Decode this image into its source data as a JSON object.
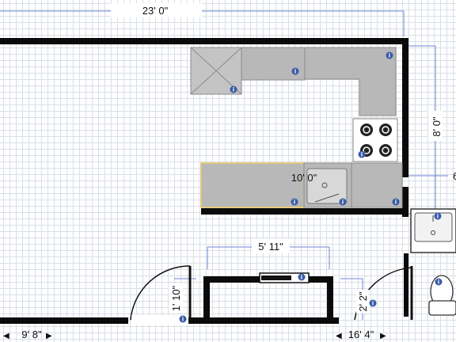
{
  "dimensions": {
    "top_width": "23' 0\"",
    "right_height": "8' 0\"",
    "counter_width": "10' 0\"",
    "right_edge": "6",
    "bathroom_width": "5' 11\"",
    "door_left_height": "1' 10\"",
    "door_right_height": "2' 2\"",
    "bottom_left": "9' 8\"",
    "bottom_right": "16' 4\""
  },
  "info_icon_glyph": "i",
  "colors": {
    "wall": "#0a0a0a",
    "counter": "#b8b8b8",
    "counter_border": "#8a8a8a",
    "selected_counter_border": "#e8c860",
    "dimension_line": "#6f86d6",
    "info_badge": "#3a5ba8",
    "grid_minor": "#d9dfe6",
    "grid_major": "#b9c2cc"
  },
  "icons": [
    "info-icon",
    "stove-burner-icon",
    "sink-icon",
    "toilet-icon",
    "door-swing-icon",
    "arrow-left-icon",
    "arrow-right-icon"
  ]
}
